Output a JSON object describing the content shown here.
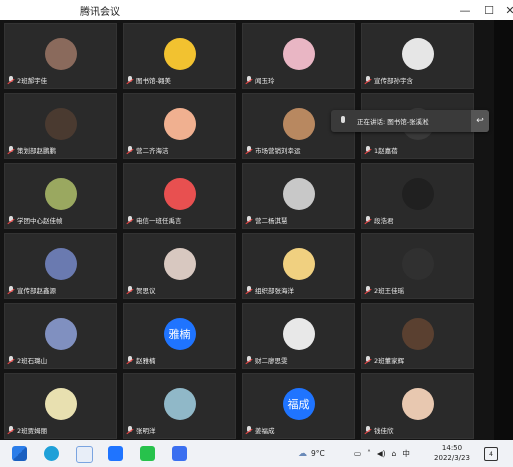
{
  "window": {
    "title": "腾讯会议",
    "controls": {
      "minimize": "—",
      "maximize": "☐",
      "close": "✕"
    }
  },
  "participants": [
    {
      "name": "2班郝宇佳",
      "avatar_text": "",
      "avatar_color": "#8a6a5c"
    },
    {
      "name": "图书馆-翱美",
      "avatar_text": "",
      "avatar_color": "#f2c230"
    },
    {
      "name": "闻玉玲",
      "avatar_text": "",
      "avatar_color": "#e9b6c4"
    },
    {
      "name": "宣传部孙宇含",
      "avatar_text": "",
      "avatar_color": "#e6e6e6"
    },
    {
      "name": "策划部赵鹏鹏",
      "avatar_text": "",
      "avatar_color": "#4a3a30"
    },
    {
      "name": "营二齐海洁",
      "avatar_text": "",
      "avatar_color": "#f0b090"
    },
    {
      "name": "市场营销刘幸运",
      "avatar_text": "",
      "avatar_color": "#b88860"
    },
    {
      "name": "1赵嘉蓓",
      "avatar_text": "",
      "avatar_color": "#3a3a3a"
    },
    {
      "name": "学团中心赵佳帧",
      "avatar_text": "",
      "avatar_color": "#9aa860"
    },
    {
      "name": "电信一班任禹言",
      "avatar_text": "",
      "avatar_color": "#e85050"
    },
    {
      "name": "营二杨淇慧",
      "avatar_text": "",
      "avatar_color": "#c8c8c8"
    },
    {
      "name": "段浩君",
      "avatar_text": "",
      "avatar_color": "#202020"
    },
    {
      "name": "宣传部赵鑫源",
      "avatar_text": "",
      "avatar_color": "#6a7ab0"
    },
    {
      "name": "贺思议",
      "avatar_text": "",
      "avatar_color": "#d8c8c0"
    },
    {
      "name": "组织部张海洋",
      "avatar_text": "",
      "avatar_color": "#f0d080"
    },
    {
      "name": "2班王佳瑶",
      "avatar_text": "",
      "avatar_color": "#303030"
    },
    {
      "name": "2班石璐山",
      "avatar_text": "",
      "avatar_color": "#8090c0"
    },
    {
      "name": "赵雅楠",
      "avatar_text": "雅楠",
      "avatar_color": "#1f74ff"
    },
    {
      "name": "财二廖思雯",
      "avatar_text": "",
      "avatar_color": "#e8e8e8"
    },
    {
      "name": "2班董家辉",
      "avatar_text": "",
      "avatar_color": "#5a4030"
    },
    {
      "name": "2班贾姆丽",
      "avatar_text": "",
      "avatar_color": "#e8e0b0"
    },
    {
      "name": "张明洋",
      "avatar_text": "",
      "avatar_color": "#90b8c8"
    },
    {
      "name": "姜福成",
      "avatar_text": "福成",
      "avatar_color": "#1f74ff"
    },
    {
      "name": "钱佳欣",
      "avatar_text": "",
      "avatar_color": "#e8c8b0"
    }
  ],
  "speaking": {
    "text": "正在讲话: 图书馆-张溪淞",
    "action_icon": "↩"
  },
  "taskbar": {
    "weather": "9°C",
    "ime": "中",
    "time": "14:50",
    "date": "2022/3/23",
    "notifications": "4"
  }
}
